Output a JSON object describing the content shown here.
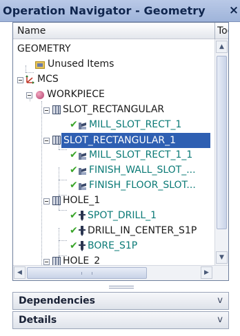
{
  "window": {
    "title": "Operation Navigator - Geometry",
    "close_glyph": "×"
  },
  "columns": {
    "name": "Name",
    "toolpath": "Toolpath"
  },
  "tree": [
    {
      "label": "GEOMETRY",
      "icon": "none"
    },
    {
      "label": "Unused Items",
      "icon": "folder-icon"
    },
    {
      "label": "MCS",
      "icon": "coordinate-system-icon"
    },
    {
      "label": "WORKPIECE",
      "icon": "workpiece-icon"
    },
    {
      "label": "SLOT_RECTANGULAR",
      "icon": "geometry-group-icon"
    },
    {
      "label": "MILL_SLOT_RECT_1",
      "icon": "mill-operation-icon",
      "status": "complete"
    },
    {
      "label": "SLOT_RECTANGULAR_1",
      "icon": "geometry-group-icon",
      "selected": true
    },
    {
      "label": "MILL_SLOT_RECT_1_1",
      "icon": "mill-operation-icon",
      "status": "complete"
    },
    {
      "label": "FINISH_WALL_SLOT_...",
      "icon": "mill-operation-icon",
      "status": "complete"
    },
    {
      "label": "FINISH_FLOOR_SLOT...",
      "icon": "mill-operation-icon",
      "status": "complete"
    },
    {
      "label": "HOLE_1",
      "icon": "geometry-group-icon"
    },
    {
      "label": "SPOT_DRILL_1",
      "icon": "drill-operation-icon",
      "status": "complete"
    },
    {
      "label": "DRILL_IN_CENTER_S1P",
      "icon": "drill-operation-icon",
      "status": "complete"
    },
    {
      "label": "BORE_S1P",
      "icon": "drill-operation-icon",
      "status": "complete"
    },
    {
      "label": "HOLE_2",
      "icon": "geometry-group-icon"
    }
  ],
  "sections": {
    "dependencies": "Dependencies",
    "details": "Details",
    "chevron": "v"
  },
  "scroll_glyphs": {
    "up": "▲",
    "down": "▼",
    "left": "◀",
    "right": "▶"
  },
  "colors": {
    "selection": "#2e5fb2",
    "operation_text": "#0a7a76",
    "check": "#3aa52a",
    "title_bar": "#a9bcdf"
  }
}
